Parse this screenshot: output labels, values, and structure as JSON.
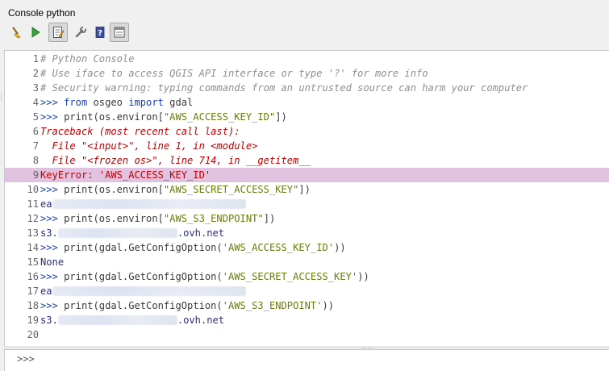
{
  "window": {
    "title": "Console python"
  },
  "toolbar": {
    "buttons": [
      {
        "icon": "broom-icon"
      },
      {
        "icon": "run-icon"
      },
      {
        "icon": "editor-icon",
        "active": true
      },
      {
        "icon": "wrench-icon"
      },
      {
        "icon": "help-icon"
      },
      {
        "icon": "settings-window-icon",
        "active": true
      }
    ]
  },
  "colors": {
    "highlight": "#e1c2e0",
    "comment": "#8e8e8e",
    "prompt": "#1b3fb4",
    "string": "#6a7a10",
    "error": "#c00000"
  },
  "console": {
    "lines": [
      {
        "n": "1",
        "parts": [
          {
            "cls": "cm",
            "t": "# Python Console"
          }
        ]
      },
      {
        "n": "2",
        "parts": [
          {
            "cls": "cm",
            "t": "# Use iface to access QGIS API interface or type '?' for more info"
          }
        ]
      },
      {
        "n": "3",
        "parts": [
          {
            "cls": "cm",
            "t": "# Security warning: typing commands from an untrusted source can harm your computer"
          }
        ]
      },
      {
        "n": "4",
        "parts": [
          {
            "cls": "pr",
            "t": ">>> "
          },
          {
            "cls": "kw",
            "t": "from"
          },
          {
            "cls": "nm",
            "t": " osgeo "
          },
          {
            "cls": "kw",
            "t": "import"
          },
          {
            "cls": "nm",
            "t": " gdal"
          }
        ]
      },
      {
        "n": "5",
        "parts": [
          {
            "cls": "pr",
            "t": ">>> "
          },
          {
            "cls": "nm",
            "t": "print(os.environ["
          },
          {
            "cls": "st",
            "t": "\"AWS_ACCESS_KEY_ID\""
          },
          {
            "cls": "nm",
            "t": "])"
          }
        ]
      },
      {
        "n": "6",
        "parts": [
          {
            "cls": "err",
            "t": "Traceback (most recent call last):"
          }
        ]
      },
      {
        "n": "7",
        "parts": [
          {
            "cls": "err",
            "t": "  File \"<input>\", line 1, in <module>"
          }
        ]
      },
      {
        "n": "8",
        "parts": [
          {
            "cls": "err",
            "t": "  File \"<frozen os>\", line 714, in __getitem__"
          }
        ]
      },
      {
        "n": "9",
        "hl": true,
        "parts": [
          {
            "cls": "errn",
            "t": "KeyError: 'AWS_ACCESS_KEY_ID'"
          }
        ]
      },
      {
        "n": "10",
        "parts": [
          {
            "cls": "pr",
            "t": ">>> "
          },
          {
            "cls": "nm",
            "t": "print(os.environ["
          },
          {
            "cls": "st",
            "t": "\"AWS_SECRET_ACCESS_KEY\""
          },
          {
            "cls": "nm",
            "t": "])"
          }
        ]
      },
      {
        "n": "11",
        "parts": [
          {
            "cls": "out",
            "t": "ea"
          },
          {
            "blur": 240
          }
        ]
      },
      {
        "n": "12",
        "parts": [
          {
            "cls": "pr",
            "t": ">>> "
          },
          {
            "cls": "nm",
            "t": "print(os.environ["
          },
          {
            "cls": "st",
            "t": "\"AWS_S3_ENDPOINT\""
          },
          {
            "cls": "nm",
            "t": "])"
          }
        ]
      },
      {
        "n": "13",
        "parts": [
          {
            "cls": "out",
            "t": "s3."
          },
          {
            "blur": 148
          },
          {
            "cls": "out",
            "t": ".ovh.net"
          }
        ]
      },
      {
        "n": "14",
        "parts": [
          {
            "cls": "pr",
            "t": ">>> "
          },
          {
            "cls": "nm",
            "t": "print(gdal.GetConfigOption("
          },
          {
            "cls": "st",
            "t": "'AWS_ACCESS_KEY_ID'"
          },
          {
            "cls": "nm",
            "t": "))"
          }
        ]
      },
      {
        "n": "15",
        "parts": [
          {
            "cls": "out",
            "t": "None"
          }
        ]
      },
      {
        "n": "16",
        "parts": [
          {
            "cls": "pr",
            "t": ">>> "
          },
          {
            "cls": "nm",
            "t": "print(gdal.GetConfigOption("
          },
          {
            "cls": "st",
            "t": "'AWS_SECRET_ACCESS_KEY'"
          },
          {
            "cls": "nm",
            "t": "))"
          }
        ]
      },
      {
        "n": "17",
        "parts": [
          {
            "cls": "out",
            "t": "ea"
          },
          {
            "blur": 240
          }
        ]
      },
      {
        "n": "18",
        "parts": [
          {
            "cls": "pr",
            "t": ">>> "
          },
          {
            "cls": "nm",
            "t": "print(gdal.GetConfigOption("
          },
          {
            "cls": "st",
            "t": "'AWS_S3_ENDPOINT'"
          },
          {
            "cls": "nm",
            "t": "))"
          }
        ]
      },
      {
        "n": "19",
        "parts": [
          {
            "cls": "out",
            "t": "s3."
          },
          {
            "blur": 148
          },
          {
            "cls": "out",
            "t": ".ovh.net"
          }
        ]
      },
      {
        "n": "20",
        "parts": []
      }
    ]
  },
  "input": {
    "prompt": ">>>"
  }
}
